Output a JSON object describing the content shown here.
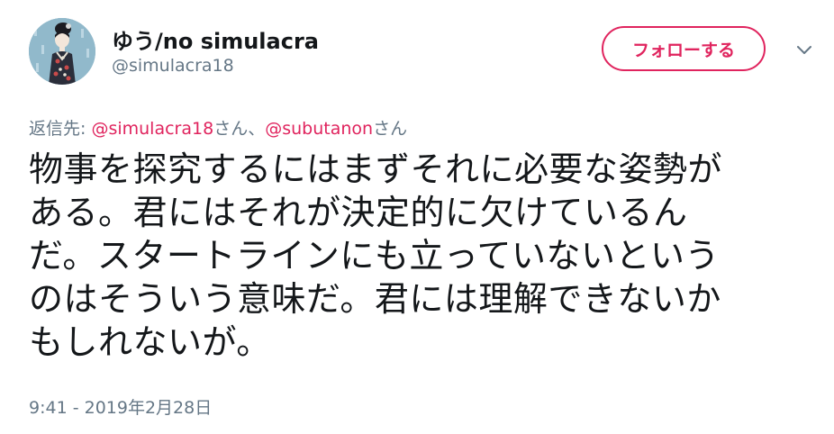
{
  "author": {
    "display_name": "ゆう/no simulacra",
    "handle": "@simulacra18"
  },
  "follow_button": {
    "label": "フォローする",
    "color": "#e0245e"
  },
  "menu": {
    "icon": "chevron-down-icon"
  },
  "reply_to": {
    "prefix": "返信先: ",
    "mentions": [
      {
        "handle": "@simulacra18",
        "suffix": "さん、"
      },
      {
        "handle": "@subutanon",
        "suffix": "さん"
      }
    ]
  },
  "tweet": {
    "lines": [
      "物事を探究するにはまずそれに必要な姿勢が",
      "ある。君にはそれが決定的に欠けているん",
      "だ。スタートラインにも立っていないという",
      "のはそういう意味だ。君には理解できないか",
      "もしれないが。"
    ]
  },
  "timestamp": "9:41 - 2019年2月28日",
  "colors": {
    "text": "#14171a",
    "secondary": "#657786",
    "accent": "#e0245e"
  }
}
